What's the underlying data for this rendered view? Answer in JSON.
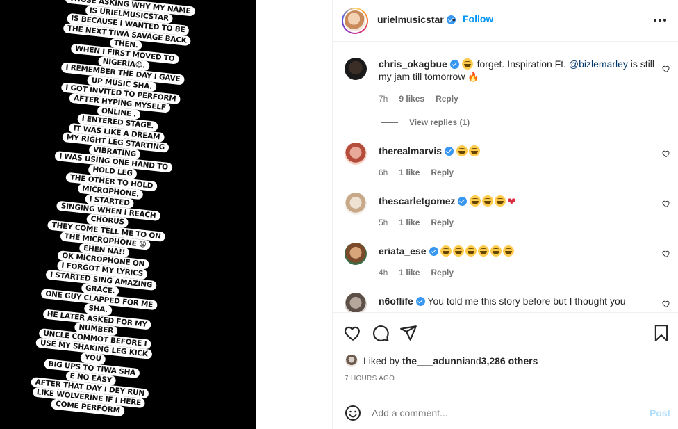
{
  "story": {
    "lines": [
      "THOSE ASKING WHY MY NAME",
      "IS URIELMUSICSTAR",
      "IS BECAUSE I WANTED TO BE",
      "THE NEXT TIWA SAVAGE BACK",
      "THEN.",
      "WHEN I FIRST MOVED TO",
      "NIGERIA😩.",
      "I REMEMBER THE DAY I GAVE",
      "UP MUSIC SHA.",
      "I GOT INVITED TO PERFORM",
      "AFTER HYPING MYSELF",
      "ONLINE .",
      "I ENTERED STAGE.",
      "IT WAS LIKE A DREAM",
      "MY RIGHT LEG STARTING",
      "VIBRATING",
      "I WAS USING ONE HAND TO",
      "HOLD LEG",
      "THE OTHER TO HOLD",
      "MICROPHONE.",
      "I STARTED",
      "SINGING WHEN I REACH",
      "CHORUS",
      "THEY COME TELL ME TO ON",
      "THE MICROPHONE 😩",
      "EHEN NA!!",
      "OK MICROPHONE ON",
      "I FORGOT MY LYRICS",
      "I STARTED SING AMAZING",
      "GRACE.",
      "ONE GUY CLAPPED FOR ME",
      "SHA.",
      "HE LATER ASKED FOR MY",
      "NUMBER",
      "UNCLE COMMOT BEFORE I",
      "USE MY SHAKING LEG KICK",
      "YOU",
      "BIG UPS TO TIWA SHA",
      "E NO EASY",
      "AFTER THAT DAY I DEY RUN",
      "LIKE  WOLVERINE IF I HERE",
      "COME PERFORM"
    ]
  },
  "header": {
    "username": "urielmusicstar",
    "separator": "•",
    "follow_label": "Follow"
  },
  "comments": [
    {
      "username": "chris_okagbue",
      "text_before": " forget. Inspiration Ft. ",
      "mention": "@bizlemarley",
      "text_after": " is still my jam till tomorrow ",
      "time": "7h",
      "likes": "9 likes",
      "reply": "Reply",
      "view_replies": "View replies (1)"
    },
    {
      "username": "therealmarvis",
      "time": "6h",
      "likes": "1 like",
      "reply": "Reply"
    },
    {
      "username": "thescarletgomez",
      "time": "5h",
      "likes": "1 like",
      "reply": "Reply"
    },
    {
      "username": "eriata_ese",
      "time": "4h",
      "likes": "1 like",
      "reply": "Reply"
    },
    {
      "username": "n6oflife",
      "text": " You told me this story before but I thought you"
    }
  ],
  "likes": {
    "prefix": "Liked by ",
    "user": "the___adunni",
    "middle": " and ",
    "others": "3,286 others"
  },
  "timestamp": "7 HOURS AGO",
  "add_comment": {
    "placeholder": "Add a comment...",
    "post_label": "Post"
  },
  "colors": {
    "accent": "#0095f6",
    "verified": "#3897f0",
    "post_disabled": "#b2dffc",
    "muted": "#737373"
  }
}
